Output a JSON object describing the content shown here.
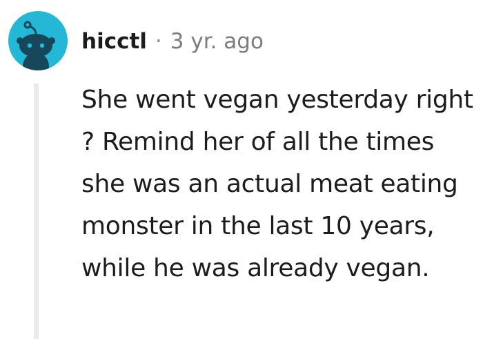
{
  "comment": {
    "avatar_icon": "reddit-snoo-avatar-icon",
    "avatar_color": "#22b8d6",
    "username": "hicctl",
    "separator": "·",
    "timestamp": "3 yr. ago",
    "body_text": "She went vegan yesterday right ? Remind her of all the times she was an actual meat eating monster in the last 10 years, while he was already vegan."
  }
}
